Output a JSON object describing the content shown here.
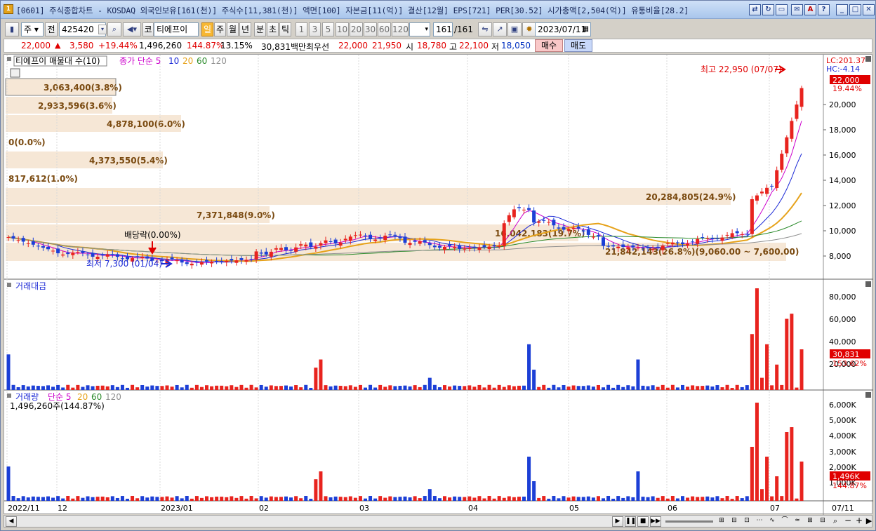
{
  "window": {
    "title": "[0601] 주식종합차트 - KOSDAQ 외국인보유[161(천)] 주식수[11,381(천)] 액면[100] 자본금[11(억)] 결산[12월] EPS[721] PER[30.52] 시가총액[2,504(억)] 유통비율[28.2]",
    "app_icon": "1"
  },
  "toolbar": {
    "type_select": "주",
    "prefix": "전",
    "code": "425420",
    "market": "코",
    "stock_name": "티에프이",
    "periods": [
      "일",
      "주",
      "월",
      "년",
      "분",
      "초",
      "틱"
    ],
    "intervals": [
      "1",
      "3",
      "5",
      "10",
      "20",
      "30",
      "60",
      "120"
    ],
    "count": "161",
    "total": "/161",
    "date": "2023/07/11"
  },
  "quote": {
    "price": "22,000",
    "change": "3,580",
    "rate": "+19.44%",
    "volume": "1,496,260",
    "vol_rate": "144.87%",
    "turnover": "13.15%",
    "amount": "30,831백만",
    "pref_label": "최우선",
    "ask": "22,000",
    "bid": "21,950",
    "open_label": "시",
    "open": "18,780",
    "high_label": "고",
    "high": "22,100",
    "low_label": "저",
    "low": "18,050",
    "buy": "매수",
    "sell": "매도"
  },
  "price_panel": {
    "legend_title": "티에프이 매물대 수(10)",
    "ma_legend": [
      "종가 단순 5",
      "10",
      "20",
      "60",
      "120"
    ],
    "lc": "LC:201.37",
    "hc": "HC:-4.14",
    "current_tag": "22,000",
    "current_rate": "19.44%",
    "high_note": "최고 22,950 (07/07)",
    "low_note": "최저 7,300 (01/04)",
    "dividend_note": "배당락(0.00%)",
    "y_ticks": [
      "22,000",
      "20,000",
      "18,000",
      "16,000",
      "14,000",
      "12,000",
      "10,000",
      "8,000"
    ],
    "volume_profile": [
      "3,063,400(3.8%)",
      "2,933,596(3.6%)",
      "4,878,100(6.0%)",
      "0(0.0%)",
      "4,373,550(5.4%)",
      "817,612(1.0%)",
      "20,284,805(24.9%)",
      "7,371,848(9.0%)",
      "16,042,183(19.7%)",
      "21,842,143(26.8%)(9,060.00 ~ 7,600.00)"
    ]
  },
  "amount_panel": {
    "title": "거래대금",
    "y_ticks": [
      "80,000",
      "60,000",
      "40,000",
      "20,000"
    ],
    "current_tag": "30,831",
    "current_rate": "153.62%"
  },
  "volume_panel": {
    "title": "거래량",
    "ma_legend": [
      "단순 5",
      "20",
      "60",
      "120"
    ],
    "value_note": "1,496,260주(144.87%)",
    "y_ticks": [
      "6,000K",
      "5,000K",
      "4,000K",
      "3,000K",
      "2,000K",
      "1,000K"
    ],
    "current_tag": "1,496K",
    "current_rate": "144.87%"
  },
  "x_axis": [
    "2022/11",
    "12",
    "2023/01",
    "02",
    "03",
    "04",
    "05",
    "06",
    "07",
    "07/11"
  ],
  "colors": {
    "up": "#e8231e",
    "down": "#1c3fd6",
    "ma5": "#cc00cc",
    "ma10": "#1c2ad6",
    "ma20": "#e6a21a",
    "ma60": "#2a8a2a",
    "ma120": "#909090",
    "profile": "#f6e7d6"
  }
}
